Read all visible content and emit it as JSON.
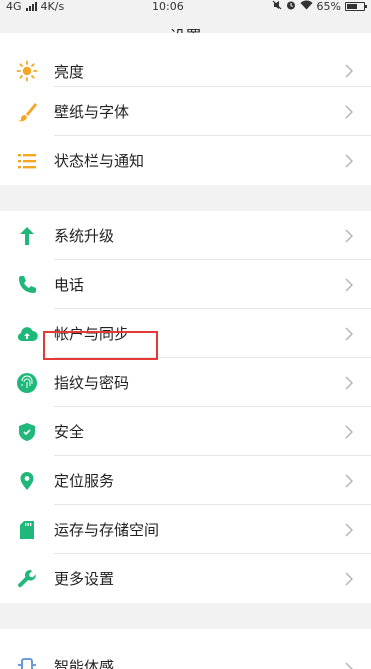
{
  "status_bar": {
    "network": "4G",
    "speed": "4K/s",
    "time": "10:06",
    "battery": "65%",
    "battery_level_percent": 65
  },
  "header": {
    "title": "设置"
  },
  "groups": [
    {
      "items": [
        {
          "label": "亮度",
          "icon": "brightness-sun-icon"
        },
        {
          "label": "壁纸与字体",
          "icon": "paintbrush-icon"
        },
        {
          "label": "状态栏与通知",
          "icon": "notification-lines-icon"
        }
      ]
    },
    {
      "items": [
        {
          "label": "系统升级",
          "icon": "arrow-up-icon"
        },
        {
          "label": "电话",
          "icon": "phone-icon"
        },
        {
          "label": "帐户与同步",
          "icon": "cloud-sync-icon"
        },
        {
          "label": "指纹与密码",
          "icon": "fingerprint-icon"
        },
        {
          "label": "安全",
          "icon": "shield-icon"
        },
        {
          "label": "定位服务",
          "icon": "location-pin-icon"
        },
        {
          "label": "运存与存储空间",
          "icon": "sd-card-icon"
        },
        {
          "label": "更多设置",
          "icon": "wrench-icon"
        }
      ]
    },
    {
      "items": [
        {
          "label": "智能体感",
          "icon": "smart-motion-icon"
        }
      ]
    }
  ],
  "colors": {
    "orange": "#f5a623",
    "green": "#1fb87a",
    "highlight": "#e53935"
  }
}
